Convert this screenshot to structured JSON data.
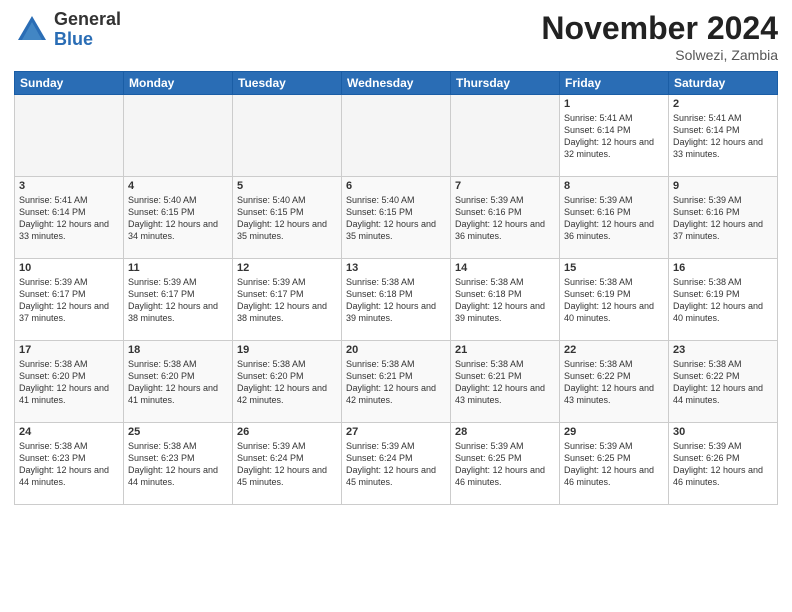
{
  "logo": {
    "general": "General",
    "blue": "Blue"
  },
  "title": "November 2024",
  "subtitle": "Solwezi, Zambia",
  "days_header": [
    "Sunday",
    "Monday",
    "Tuesday",
    "Wednesday",
    "Thursday",
    "Friday",
    "Saturday"
  ],
  "weeks": [
    [
      {
        "day": "",
        "info": ""
      },
      {
        "day": "",
        "info": ""
      },
      {
        "day": "",
        "info": ""
      },
      {
        "day": "",
        "info": ""
      },
      {
        "day": "",
        "info": ""
      },
      {
        "day": "1",
        "info": "Sunrise: 5:41 AM\nSunset: 6:14 PM\nDaylight: 12 hours\nand 32 minutes."
      },
      {
        "day": "2",
        "info": "Sunrise: 5:41 AM\nSunset: 6:14 PM\nDaylight: 12 hours\nand 33 minutes."
      }
    ],
    [
      {
        "day": "3",
        "info": "Sunrise: 5:41 AM\nSunset: 6:14 PM\nDaylight: 12 hours\nand 33 minutes."
      },
      {
        "day": "4",
        "info": "Sunrise: 5:40 AM\nSunset: 6:15 PM\nDaylight: 12 hours\nand 34 minutes."
      },
      {
        "day": "5",
        "info": "Sunrise: 5:40 AM\nSunset: 6:15 PM\nDaylight: 12 hours\nand 35 minutes."
      },
      {
        "day": "6",
        "info": "Sunrise: 5:40 AM\nSunset: 6:15 PM\nDaylight: 12 hours\nand 35 minutes."
      },
      {
        "day": "7",
        "info": "Sunrise: 5:39 AM\nSunset: 6:16 PM\nDaylight: 12 hours\nand 36 minutes."
      },
      {
        "day": "8",
        "info": "Sunrise: 5:39 AM\nSunset: 6:16 PM\nDaylight: 12 hours\nand 36 minutes."
      },
      {
        "day": "9",
        "info": "Sunrise: 5:39 AM\nSunset: 6:16 PM\nDaylight: 12 hours\nand 37 minutes."
      }
    ],
    [
      {
        "day": "10",
        "info": "Sunrise: 5:39 AM\nSunset: 6:17 PM\nDaylight: 12 hours\nand 37 minutes."
      },
      {
        "day": "11",
        "info": "Sunrise: 5:39 AM\nSunset: 6:17 PM\nDaylight: 12 hours\nand 38 minutes."
      },
      {
        "day": "12",
        "info": "Sunrise: 5:39 AM\nSunset: 6:17 PM\nDaylight: 12 hours\nand 38 minutes."
      },
      {
        "day": "13",
        "info": "Sunrise: 5:38 AM\nSunset: 6:18 PM\nDaylight: 12 hours\nand 39 minutes."
      },
      {
        "day": "14",
        "info": "Sunrise: 5:38 AM\nSunset: 6:18 PM\nDaylight: 12 hours\nand 39 minutes."
      },
      {
        "day": "15",
        "info": "Sunrise: 5:38 AM\nSunset: 6:19 PM\nDaylight: 12 hours\nand 40 minutes."
      },
      {
        "day": "16",
        "info": "Sunrise: 5:38 AM\nSunset: 6:19 PM\nDaylight: 12 hours\nand 40 minutes."
      }
    ],
    [
      {
        "day": "17",
        "info": "Sunrise: 5:38 AM\nSunset: 6:20 PM\nDaylight: 12 hours\nand 41 minutes."
      },
      {
        "day": "18",
        "info": "Sunrise: 5:38 AM\nSunset: 6:20 PM\nDaylight: 12 hours\nand 41 minutes."
      },
      {
        "day": "19",
        "info": "Sunrise: 5:38 AM\nSunset: 6:20 PM\nDaylight: 12 hours\nand 42 minutes."
      },
      {
        "day": "20",
        "info": "Sunrise: 5:38 AM\nSunset: 6:21 PM\nDaylight: 12 hours\nand 42 minutes."
      },
      {
        "day": "21",
        "info": "Sunrise: 5:38 AM\nSunset: 6:21 PM\nDaylight: 12 hours\nand 43 minutes."
      },
      {
        "day": "22",
        "info": "Sunrise: 5:38 AM\nSunset: 6:22 PM\nDaylight: 12 hours\nand 43 minutes."
      },
      {
        "day": "23",
        "info": "Sunrise: 5:38 AM\nSunset: 6:22 PM\nDaylight: 12 hours\nand 44 minutes."
      }
    ],
    [
      {
        "day": "24",
        "info": "Sunrise: 5:38 AM\nSunset: 6:23 PM\nDaylight: 12 hours\nand 44 minutes."
      },
      {
        "day": "25",
        "info": "Sunrise: 5:38 AM\nSunset: 6:23 PM\nDaylight: 12 hours\nand 44 minutes."
      },
      {
        "day": "26",
        "info": "Sunrise: 5:39 AM\nSunset: 6:24 PM\nDaylight: 12 hours\nand 45 minutes."
      },
      {
        "day": "27",
        "info": "Sunrise: 5:39 AM\nSunset: 6:24 PM\nDaylight: 12 hours\nand 45 minutes."
      },
      {
        "day": "28",
        "info": "Sunrise: 5:39 AM\nSunset: 6:25 PM\nDaylight: 12 hours\nand 46 minutes."
      },
      {
        "day": "29",
        "info": "Sunrise: 5:39 AM\nSunset: 6:25 PM\nDaylight: 12 hours\nand 46 minutes."
      },
      {
        "day": "30",
        "info": "Sunrise: 5:39 AM\nSunset: 6:26 PM\nDaylight: 12 hours\nand 46 minutes."
      }
    ]
  ]
}
